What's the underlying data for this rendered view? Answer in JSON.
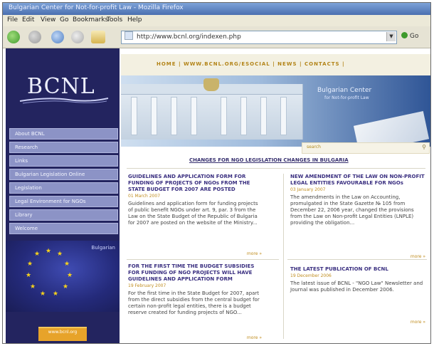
{
  "window": {
    "title": "Bulgarian Center for Not-for-profit Law - Mozilla Firefox"
  },
  "menu": [
    "File",
    "Edit",
    "View",
    "Go",
    "Bookmarks",
    "Tools",
    "Help"
  ],
  "toolbar": {
    "url": "http://www.bcnl.org/indexen.php",
    "go_label": "Go"
  },
  "site": {
    "logo_text": "BCNL",
    "top_nav": "HOME | WWW.BCNL.ORG/ESOCIAL | NEWS | CONTACTS |",
    "banner_title": "Bulgarian Center",
    "banner_subtitle": "for Not-for-profit Law",
    "search_placeholder": "search",
    "page_heading": "CHANGES FOR NGO LEGISLATION CHANGES IN BULGARIA",
    "sidebar_items": [
      "About BCNL",
      "Research",
      "Links",
      "Bulgarian Legislation Online",
      "Legislation",
      "Legal Environment for NGOs",
      "Library",
      "Welcome"
    ],
    "flag_label": "Bulgarian",
    "badge_label": "www.bcnl.org"
  },
  "news": [
    {
      "title": "GUIDELINES AND APPLICATION FORM FOR FUNDING OF PROJECTS OF NGOs FROM THE STATE BUDGET FOR 2007 ARE POSTED",
      "date": "01 March 2007",
      "body": "Guidelines and application form for funding projects of public benefit NGOs under art. 9, par. 3 from the Law on the State Budget of the Republic of Bulgaria for 2007 are posted on the website of the Ministry...",
      "more": "more »"
    },
    {
      "title": "NEW AMENDMENT OF THE LAW ON NON-PROFIT LEGAL ENTITIES FAVOURABLE FOR NGOs",
      "date": "03 January 2007",
      "body": "The amendments in the Law on Accounting, promulgated in the State Gazette № 105 from December 22, 2006 year, changed the provisions from the Law on Non-profit Legal Entities (LNPLE) providing the obligation...",
      "more": "more »"
    },
    {
      "title": "FOR THE FIRST TIME THE BUDGET SUBSIDIES FOR FUNDING OF NGO PROJECTS WILL HAVE GUIDELINES AND APPLICATION FORM",
      "date": "19 February 2007",
      "body": "For the first time in the State Budget for 2007, apart from the direct subsidies from the central budget for certain non-profit legal entities, there is a budget reserve created for funding projects of NGO...",
      "more": "more »"
    },
    {
      "title": "THE LATEST PUBLICATION OF BCNL",
      "date": "19 December 2006",
      "body": "The latest issue of BCNL - \"NGO Law\" Newsletter and Journal was published in December 2006.",
      "more": "more »"
    }
  ],
  "colors": {
    "sidebar": "#23245f",
    "menu_item": "#8c93c6",
    "accent": "#c08d1f",
    "news_title": "#3a2f80"
  }
}
